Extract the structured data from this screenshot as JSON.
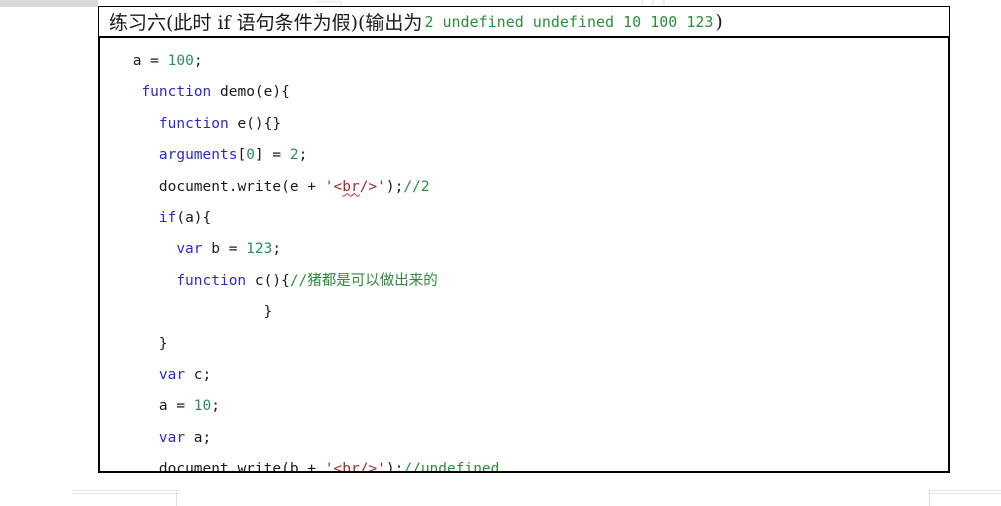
{
  "document": {
    "title": {
      "chinese_prefix": "练习六(此时 if 语句条件为假)(输出为",
      "output_values": "2 undefined undefined 10 100 123",
      "chinese_suffix": ")"
    },
    "code_lines": [
      {
        "indent": 1,
        "tokens": [
          {
            "text": "a = ",
            "type": "plain"
          },
          {
            "text": "100",
            "type": "num"
          },
          {
            "text": ";",
            "type": "plain"
          }
        ]
      },
      {
        "indent": 2,
        "tokens": [
          {
            "text": "function",
            "type": "kw"
          },
          {
            "text": " demo(e){",
            "type": "plain"
          }
        ]
      },
      {
        "indent": 4,
        "tokens": [
          {
            "text": "function",
            "type": "kw"
          },
          {
            "text": " e(){}",
            "type": "plain"
          }
        ]
      },
      {
        "indent": 4,
        "tokens": [
          {
            "text": "arguments",
            "type": "kw"
          },
          {
            "text": "[",
            "type": "plain"
          },
          {
            "text": "0",
            "type": "num"
          },
          {
            "text": "] = ",
            "type": "plain"
          },
          {
            "text": "2",
            "type": "num"
          },
          {
            "text": ";",
            "type": "plain"
          }
        ]
      },
      {
        "indent": 4,
        "tokens": [
          {
            "text": "document.write(e + ",
            "type": "plain"
          },
          {
            "text": "'<",
            "type": "str"
          },
          {
            "text": "br",
            "type": "str-squiggly"
          },
          {
            "text": "/>'",
            "type": "str"
          },
          {
            "text": ");",
            "type": "plain"
          },
          {
            "text": "//2",
            "type": "cmt"
          }
        ]
      },
      {
        "indent": 4,
        "tokens": [
          {
            "text": "if",
            "type": "kw"
          },
          {
            "text": "(a){",
            "type": "plain"
          }
        ]
      },
      {
        "indent": 6,
        "tokens": [
          {
            "text": "var",
            "type": "kw"
          },
          {
            "text": " b = ",
            "type": "plain"
          },
          {
            "text": "123",
            "type": "num"
          },
          {
            "text": ";",
            "type": "plain"
          }
        ]
      },
      {
        "indent": 6,
        "tokens": [
          {
            "text": "function",
            "type": "kw"
          },
          {
            "text": " c(){",
            "type": "plain"
          },
          {
            "text": "//猪都是可以做出来的",
            "type": "cmt"
          }
        ]
      },
      {
        "indent": 16,
        "tokens": [
          {
            "text": "}",
            "type": "plain"
          }
        ]
      },
      {
        "indent": 4,
        "tokens": [
          {
            "text": "}",
            "type": "plain"
          }
        ]
      },
      {
        "indent": 4,
        "tokens": [
          {
            "text": "var",
            "type": "kw"
          },
          {
            "text": " c;",
            "type": "plain"
          }
        ]
      },
      {
        "indent": 4,
        "tokens": [
          {
            "text": "a = ",
            "type": "plain"
          },
          {
            "text": "10",
            "type": "num"
          },
          {
            "text": ";",
            "type": "plain"
          }
        ]
      },
      {
        "indent": 4,
        "tokens": [
          {
            "text": "var",
            "type": "kw"
          },
          {
            "text": " a;",
            "type": "plain"
          }
        ]
      },
      {
        "indent": 4,
        "tokens": [
          {
            "text": "document.write(b + ",
            "type": "plain"
          },
          {
            "text": "'<",
            "type": "str"
          },
          {
            "text": "br",
            "type": "str-squiggly"
          },
          {
            "text": "/>'",
            "type": "str"
          },
          {
            "text": ");",
            "type": "plain"
          },
          {
            "text": "//undefined",
            "type": "cmt"
          }
        ]
      }
    ]
  },
  "colors": {
    "keyword": "#2b2bc4",
    "number": "#2e8b57",
    "string": "#9b2d2d",
    "comment": "#2f8a3e",
    "text": "#1a1a1a",
    "border": "#000000",
    "background": "#ffffff",
    "spellcheck_underline": "#d93025"
  }
}
